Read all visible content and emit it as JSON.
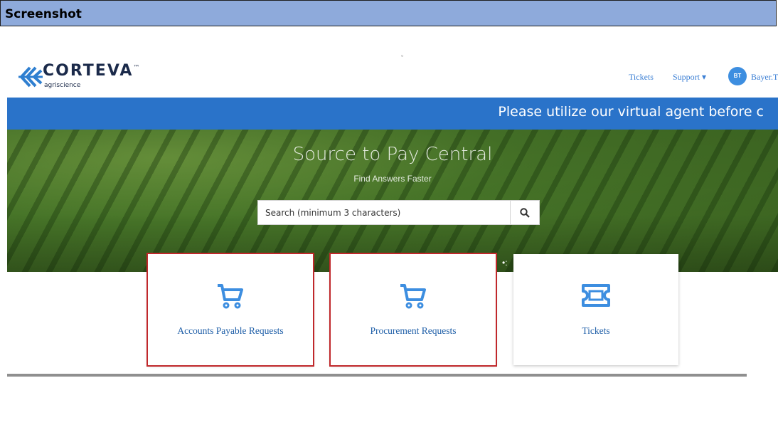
{
  "doc": {
    "heading": "Screenshot"
  },
  "header": {
    "brand": "CORTEVA",
    "tm": "™",
    "brand_sub": "agriscience",
    "nav": {
      "tickets": "Tickets",
      "support": "Support ▾"
    },
    "avatar_initials": "BT",
    "user_name": "Bayer.T"
  },
  "banner": {
    "text": "Please utilize our virtual agent before c"
  },
  "hero": {
    "title": "Source to Pay Central",
    "subtitle": "Find Answers Faster",
    "search": {
      "placeholder": "Search (minimum 3 characters)"
    }
  },
  "cards": [
    {
      "label": "Accounts Payable Requests",
      "icon": "cart-icon",
      "selected": true
    },
    {
      "label": "Procurement Requests",
      "icon": "cart-icon",
      "selected": true
    },
    {
      "label": "Tickets",
      "icon": "ticket-icon",
      "selected": false
    }
  ],
  "colors": {
    "brand_blue": "#2a73c9",
    "link_blue": "#3b7fd4",
    "highlight_red": "#c0282b"
  }
}
